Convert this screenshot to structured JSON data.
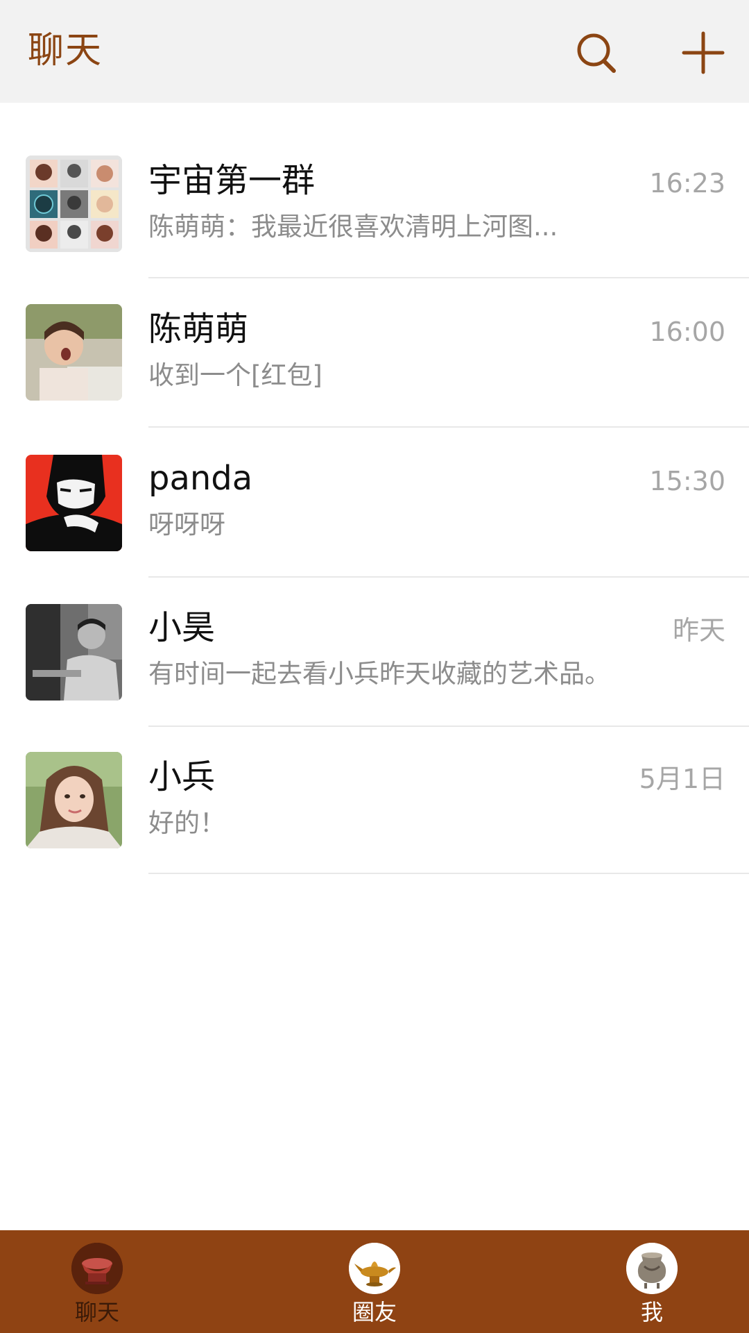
{
  "header": {
    "title": "聊天",
    "search_icon": "search-icon",
    "add_icon": "plus-icon",
    "accent_color": "#8b4513"
  },
  "chats": [
    {
      "name": "宇宙第一群",
      "time": "16:23",
      "preview": "陈萌萌：我最近很喜欢清明上河图..."
    },
    {
      "name": "陈萌萌",
      "time": "16:00",
      "preview": "收到一个[红包]"
    },
    {
      "name": "panda",
      "time": "15:30",
      "preview": "呀呀呀"
    },
    {
      "name": "小昊",
      "time": "昨天",
      "preview": "有时间一起去看小兵昨天收藏的艺术品。"
    },
    {
      "name": "小兵",
      "time": "5月1日",
      "preview": "好的！"
    }
  ],
  "nav": {
    "background_color": "#8f4313",
    "items": [
      {
        "label": "聊天",
        "icon": "chat-tab-icon",
        "active": true
      },
      {
        "label": "圈友",
        "icon": "friends-tab-icon",
        "active": false
      },
      {
        "label": "我",
        "icon": "me-tab-icon",
        "active": false
      }
    ]
  }
}
